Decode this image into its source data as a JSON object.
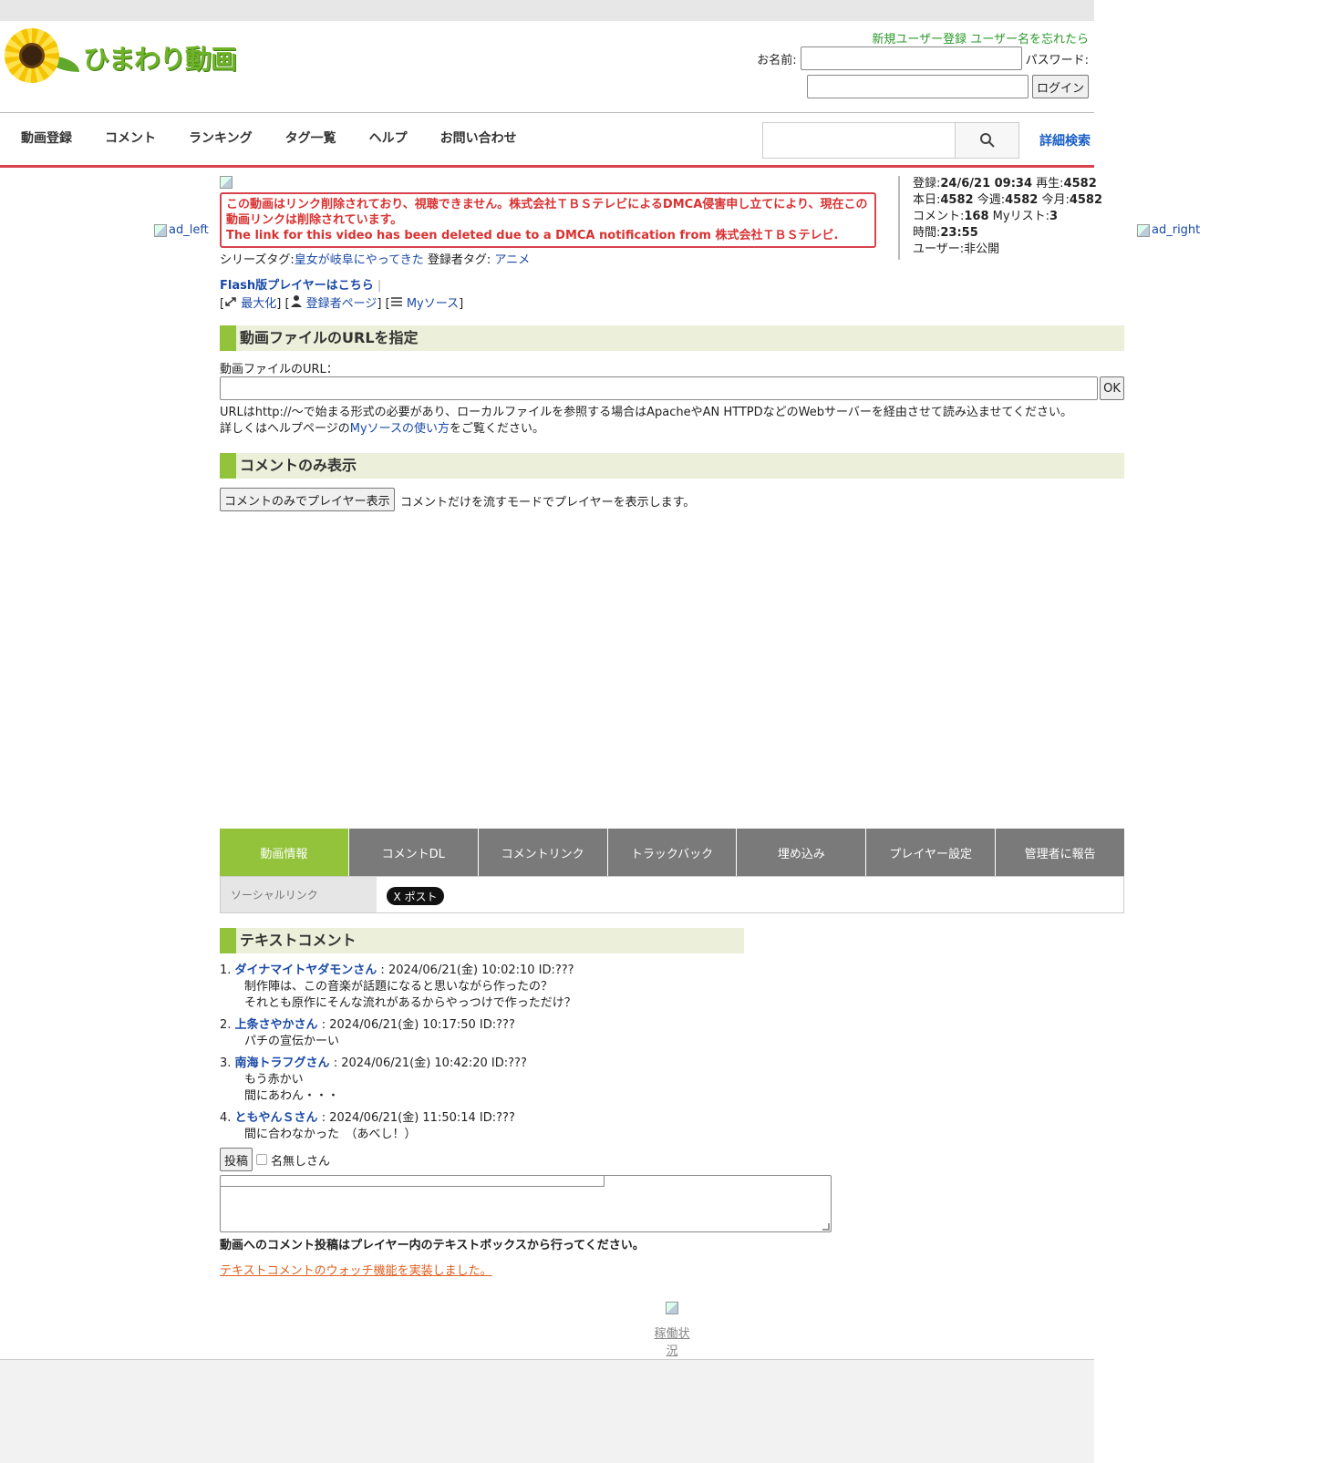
{
  "header": {
    "logo_text": "ひまわり動画",
    "register_link": "新規ユーザー登録",
    "forgot_link": "ユーザー名を忘れたら",
    "name_label": "お名前:",
    "password_label": "パスワード:",
    "login_button": "ログイン"
  },
  "nav": {
    "items": [
      "動画登録",
      "コメント",
      "ランキング",
      "タグ一覧",
      "ヘルプ",
      "お問い合わせ"
    ],
    "advanced_search": "詳細検索"
  },
  "ads": {
    "left": "ad_left",
    "right": "ad_right"
  },
  "video": {
    "alert_jp": "この動画はリンク削除されており、視聴できません。株式会社ＴＢＳテレビによるDMCA侵害申し立てにより、現在この動画リンクは削除されています。",
    "alert_en": "The link for this video has been deleted due to a DMCA notification from 株式会社ＴＢＳテレビ.",
    "series_tag_label": "シリーズタグ:",
    "series_tag": "皇女が岐阜にやってきた",
    "uploader_tag_label": "登録者タグ:",
    "uploader_tag": "アニメ",
    "flash_link": "Flash版プレイヤーはこちら",
    "maximize": "最大化",
    "uploader_page": "登録者ページ",
    "my_source": "Myソース"
  },
  "stats": {
    "registered_label": "登録:",
    "registered": "24/6/21 09:34",
    "plays_label": "再生:",
    "plays": "4582",
    "today_label": "本日:",
    "today": "4582",
    "week_label": "今週:",
    "week": "4582",
    "month_label": "今月:",
    "month": "4582",
    "comments_label": "コメント:",
    "comments": "168",
    "mylist_label": "Myリスト:",
    "mylist": "3",
    "duration_label": "時間:",
    "duration": "23:55",
    "user_label": "ユーザー:",
    "user": "非公開"
  },
  "url_section": {
    "title": "動画ファイルのURLを指定",
    "label": "動画ファイルのURL：",
    "ok": "OK",
    "note1": "URLはhttp://～で始まる形式の必要があり、ローカルファイルを参照する場合はApacheやAN HTTPDなどのWebサーバーを経由させて読み込ませてください。",
    "note2_pre": "詳しくはヘルプページの",
    "note2_link": "Myソースの使い方",
    "note2_post": "をご覧ください。"
  },
  "comment_only": {
    "title": "コメントのみ表示",
    "button": "コメントのみでプレイヤー表示",
    "desc": "コメントだけを流すモードでプレイヤーを表示します。"
  },
  "tabs": [
    "動画情報",
    "コメントDL",
    "コメントリンク",
    "トラックバック",
    "埋め込み",
    "プレイヤー設定",
    "管理者に報告"
  ],
  "social": {
    "label": "ソーシャルリンク",
    "x_button": "X ポスト"
  },
  "text_comments": {
    "title": "テキストコメント",
    "items": [
      {
        "num": "1.",
        "name": "ダイナマイトヤダモンさん",
        "meta": " : 2024/06/21(金) 10:02:10 ID:???",
        "line1": "制作陣は、この音楽が話題になると思いながら作ったの？",
        "line2": "それとも原作にそんな流れがあるからやっつけで作っただけ？"
      },
      {
        "num": "2.",
        "name": "上条さやかさん",
        "meta": " : 2024/06/21(金) 10:17:50 ID:???",
        "line1": "パチの宣伝かーい",
        "line2": ""
      },
      {
        "num": "3.",
        "name": "南海トラフグさん",
        "meta": " : 2024/06/21(金) 10:42:20 ID:???",
        "line1": "もう赤かい",
        "line2": "間にあわん・・・"
      },
      {
        "num": "4.",
        "name": "ともやんＳさん",
        "meta": " : 2024/06/21(金) 11:50:14 ID:???",
        "line1": "間に合わなかった　（あべし！）",
        "line2": ""
      }
    ],
    "post_button": "投稿",
    "anonymous_label": "名無しさん",
    "instruction": "動画へのコメント投稿はプレイヤー内のテキストボックスから行ってください。",
    "watch_link": "テキストコメントのウォッチ機能を実装しました。"
  },
  "footer": {
    "status_link": "稼働状況"
  }
}
